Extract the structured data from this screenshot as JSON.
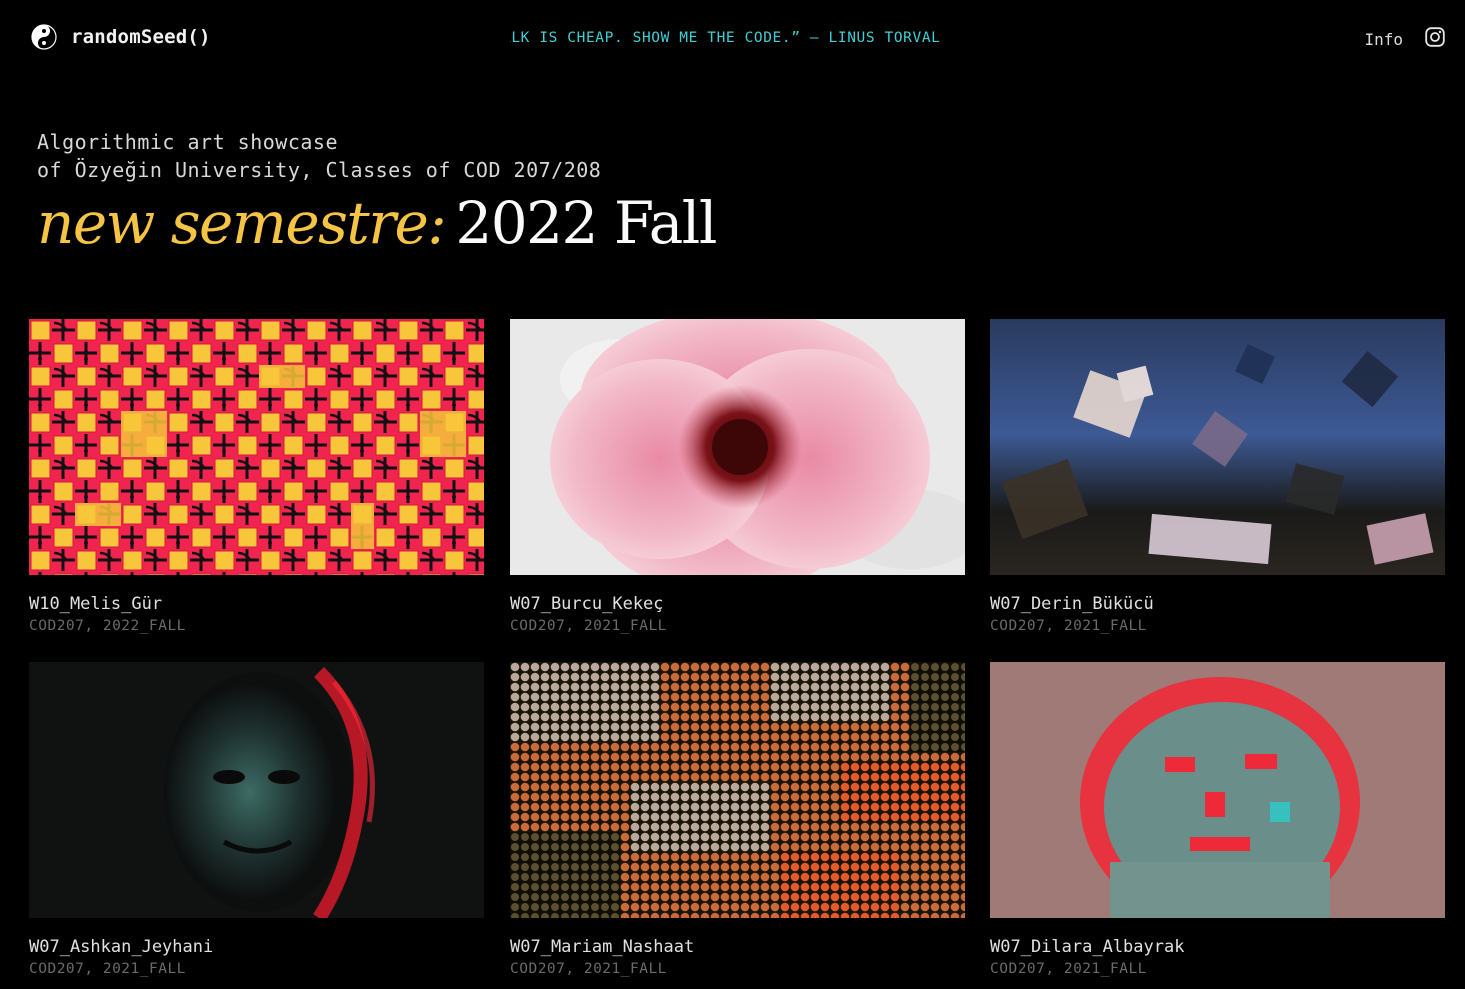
{
  "header": {
    "logo_text": "randomSeed()",
    "logo_icon": "yin-yang-icon",
    "marquee_text": "ALK IS CHEAP. SHOW ME THE CODE.” – LINUS TORVAL",
    "marquee_color": "#3fd0d6",
    "info_label": "Info",
    "social_icon": "instagram-icon"
  },
  "hero": {
    "subtitle_line1": "Algorithmic art showcase",
    "subtitle_line2": "of Özyeğin University, Classes of COD 207/208",
    "headline_prefix": "new semestre:",
    "headline_season": "2022 Fall",
    "accent_color": "#f6c445"
  },
  "gallery": {
    "items": [
      {
        "title": "W10_Melis_Gür",
        "meta": "COD207, 2022_FALL",
        "artwork": "red-yellow-tile-pattern"
      },
      {
        "title": "W07_Burcu_Kekeç",
        "meta": "COD207, 2021_FALL",
        "artwork": "pink-flower-brush"
      },
      {
        "title": "W07_Derin_Bükücü",
        "meta": "COD207, 2021_FALL",
        "artwork": "pixel-mosaic-landscape"
      },
      {
        "title": "W07_Ashkan_Jeyhani",
        "meta": "COD207, 2021_FALL",
        "artwork": "text-portrait"
      },
      {
        "title": "W07_Mariam_Nashaat",
        "meta": "COD207, 2021_FALL",
        "artwork": "dot-grid-flowers"
      },
      {
        "title": "W07_Dilara_Albayrak",
        "meta": "COD207, 2021_FALL",
        "artwork": "red-teal-pixel-face"
      }
    ]
  }
}
